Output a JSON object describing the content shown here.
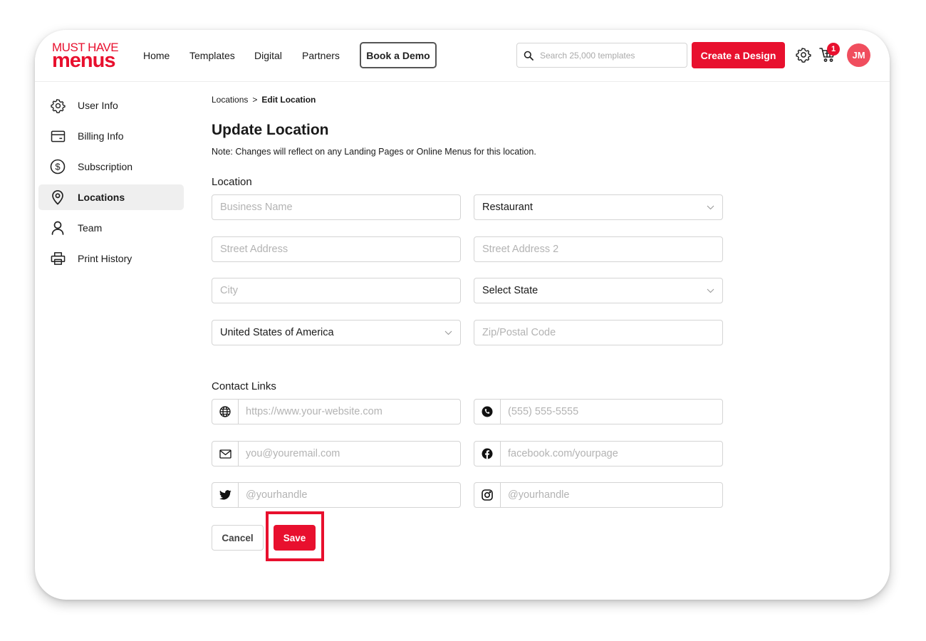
{
  "brand": {
    "logo_top": "MUST HAVE",
    "logo_bottom": "menus",
    "accent_color": "#e8102e"
  },
  "header": {
    "nav": [
      "Home",
      "Templates",
      "Digital",
      "Partners"
    ],
    "demo_label": "Book a Demo",
    "search_placeholder": "Search 25,000 templates",
    "create_label": "Create a Design",
    "cart_count": "1",
    "avatar_initials": "JM",
    "icons": [
      "search-icon",
      "gear-icon",
      "cart-icon"
    ]
  },
  "sidebar": {
    "items": [
      {
        "label": "User Info",
        "icon": "gear-icon",
        "active": false
      },
      {
        "label": "Billing Info",
        "icon": "credit-card-icon",
        "active": false
      },
      {
        "label": "Subscription",
        "icon": "dollar-icon",
        "active": false
      },
      {
        "label": "Locations",
        "icon": "map-pin-icon",
        "active": true
      },
      {
        "label": "Team",
        "icon": "user-icon",
        "active": false
      },
      {
        "label": "Print History",
        "icon": "printer-icon",
        "active": false
      }
    ]
  },
  "breadcrumb": {
    "parent": "Locations",
    "separator": ">",
    "current": "Edit Location"
  },
  "page": {
    "title": "Update Location",
    "note": "Note: Changes will reflect on any Landing Pages or Online Menus for this location."
  },
  "location": {
    "heading": "Location",
    "business_name_placeholder": "Business Name",
    "business_type": "Restaurant",
    "street_placeholder": "Street Address",
    "street2_placeholder": "Street Address 2",
    "city_placeholder": "City",
    "state": "Select State",
    "country": "United States of America",
    "zip_placeholder": "Zip/Postal Code"
  },
  "contact": {
    "heading": "Contact Links",
    "website_placeholder": "https://www.your-website.com",
    "phone_placeholder": "(555) 555-5555",
    "email_placeholder": "you@youremail.com",
    "facebook_placeholder": "facebook.com/yourpage",
    "twitter_placeholder": "@yourhandle",
    "instagram_placeholder": "@yourhandle"
  },
  "actions": {
    "cancel_label": "Cancel",
    "save_label": "Save"
  }
}
